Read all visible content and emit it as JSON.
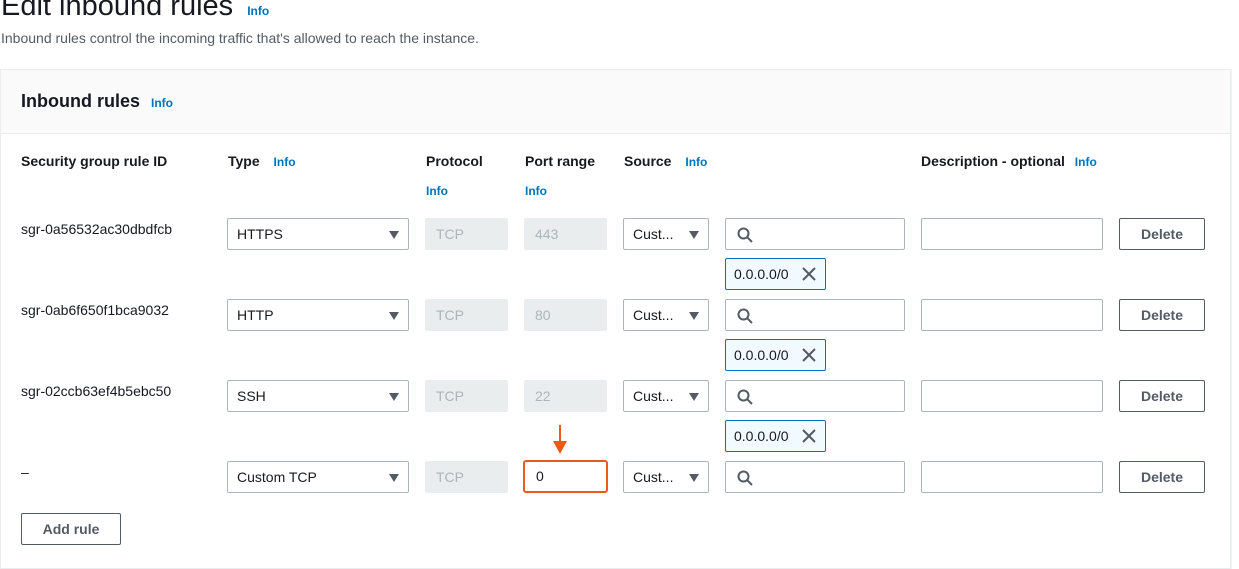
{
  "page": {
    "title": "Edit inbound rules",
    "title_info": "Info",
    "description": "Inbound rules control the incoming traffic that's allowed to reach the instance."
  },
  "panel": {
    "title": "Inbound rules",
    "title_info": "Info"
  },
  "columns": {
    "rule_id": "Security group rule ID",
    "type": "Type",
    "type_info": "Info",
    "protocol": "Protocol",
    "protocol_info": "Info",
    "port_range": "Port range",
    "port_range_info": "Info",
    "source": "Source",
    "source_info": "Info",
    "description": "Description - optional",
    "description_info": "Info"
  },
  "rules": [
    {
      "id": "sgr-0a56532ac30dbdfcb",
      "type": "HTTPS",
      "protocol": "TCP",
      "port": "443",
      "source": "Cust...",
      "search_value": "",
      "token": "0.0.0.0/0",
      "description": "",
      "delete_label": "Delete"
    },
    {
      "id": "sgr-0ab6f650f1bca9032",
      "type": "HTTP",
      "protocol": "TCP",
      "port": "80",
      "source": "Cust...",
      "search_value": "",
      "token": "0.0.0.0/0",
      "description": "",
      "delete_label": "Delete"
    },
    {
      "id": "sgr-02ccb63ef4b5ebc50",
      "type": "SSH",
      "protocol": "TCP",
      "port": "22",
      "source": "Cust...",
      "search_value": "",
      "token": "0.0.0.0/0",
      "description": "",
      "delete_label": "Delete"
    },
    {
      "id": "–",
      "type": "Custom TCP",
      "protocol": "TCP",
      "port": "0",
      "source": "Cust...",
      "search_value": "",
      "token": "",
      "description": "",
      "delete_label": "Delete"
    }
  ],
  "actions": {
    "add_rule": "Add rule"
  },
  "colors": {
    "info_link": "#0073bb",
    "highlight": "#ec5a17",
    "token_border": "#0073bb"
  },
  "icons": {
    "caret": "caret-down-icon",
    "search": "search-icon",
    "token_remove": "close-icon",
    "annotation": "arrow-down-icon"
  }
}
